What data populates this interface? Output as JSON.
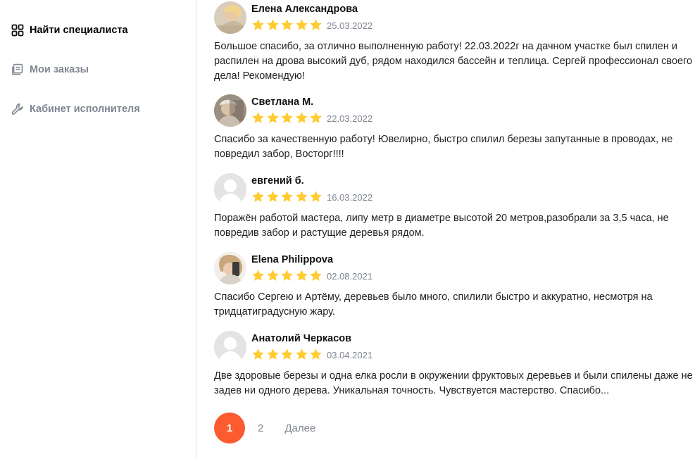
{
  "sidebar": {
    "items": [
      {
        "label": "Найти специалиста",
        "icon": "grid-icon",
        "active": true
      },
      {
        "label": "Мои заказы",
        "icon": "orders-icon",
        "active": false
      },
      {
        "label": "Кабинет исполнителя",
        "icon": "wrench-icon",
        "active": false
      }
    ]
  },
  "reviews": [
    {
      "author": "Елена Александрова",
      "date": "25.03.2022",
      "rating": 5,
      "avatar": "photo",
      "text": "Большое спасибо, за отлично выполненную работу! 22.03.2022г на дачном участке был спилен и распилен на дрова высокий дуб, рядом находился бассейн и теплица. Сергей профессионал своего дела! Рекомендую!"
    },
    {
      "author": "Светлана М.",
      "date": "22.03.2022",
      "rating": 5,
      "avatar": "photo",
      "text": "Спасибо за качественную работу! Ювелирно, быстро спилил березы запутанные в проводах, не повредил забор, Восторг!!!!"
    },
    {
      "author": "евгений б.",
      "date": "16.03.2022",
      "rating": 5,
      "avatar": "placeholder",
      "text": "Поражён работой мастера, липу метр в диаметре высотой 20 метров,разобрали за 3,5 часа, не повредив забор и растущие деревья рядом."
    },
    {
      "author": "Elena Philippova",
      "date": "02.08.2021",
      "rating": 5,
      "avatar": "photo",
      "text": "Спасибо Сергею и Артёму, деревьев было много, спилили быстро и аккуратно, несмотря на тридцатиградусную жару."
    },
    {
      "author": "Анатолий Черкасов",
      "date": "03.04.2021",
      "rating": 5,
      "avatar": "placeholder",
      "text": "Две здоровые березы и одна елка росли в окружении фруктовых деревьев и были спилены даже не задев ни одного дерева. Уникальная точность. Чувствуется мастерство. Спасибо..."
    }
  ],
  "pagination": {
    "current": "1",
    "pages": [
      "2"
    ],
    "next_label": "Далее"
  },
  "colors": {
    "accent": "#fc5a2f",
    "star": "#ffcc33",
    "muted": "#7f8591"
  }
}
